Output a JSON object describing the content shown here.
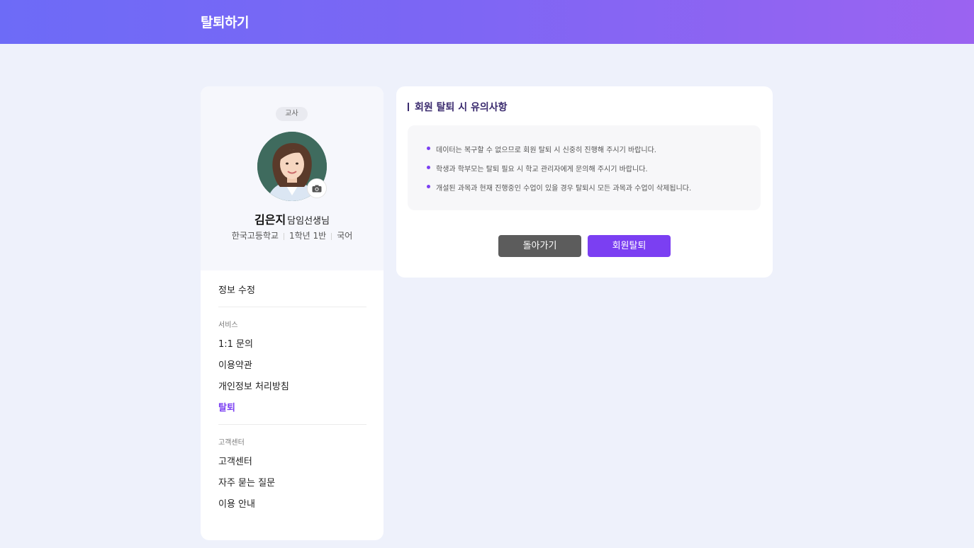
{
  "header": {
    "title": "탈퇴하기"
  },
  "profile": {
    "role_badge": "교사",
    "name": "김은지",
    "title": "담임선생님",
    "school": "한국고등학교",
    "class": "1학년 1반",
    "subject": "국어"
  },
  "menu": {
    "edit_info": "정보 수정",
    "service_section": "서비스",
    "service_items": [
      "1:1 문의",
      "이용약관",
      "개인정보 처리방침",
      "탈퇴"
    ],
    "support_section": "고객센터",
    "support_items": [
      "고객센터",
      "자주 묻는 질문",
      "이용 안내"
    ]
  },
  "notice": {
    "title": "회원 탈퇴 시 유의사항",
    "items": [
      "데이터는 복구할 수 없으므로 회원 탈퇴 시 신중히 진행해 주시기 바랍니다.",
      "학생과 학부모는 탈퇴 필요 시 학교 관리자에게 문의해 주시기 바랍니다.",
      "개설된 과목과 현재 진행중인 수업이 있을 경우 탈퇴시 모든 과목과 수업이 삭제됩니다."
    ]
  },
  "buttons": {
    "back": "돌아가기",
    "withdraw": "회원탈퇴"
  },
  "colors": {
    "accent": "#7b3ff2",
    "header_start": "#6d6bf7",
    "header_end": "#9b63f1",
    "back_button": "#5c5c5c"
  },
  "icons": {
    "camera": "camera-icon",
    "avatar": "profile-photo"
  }
}
